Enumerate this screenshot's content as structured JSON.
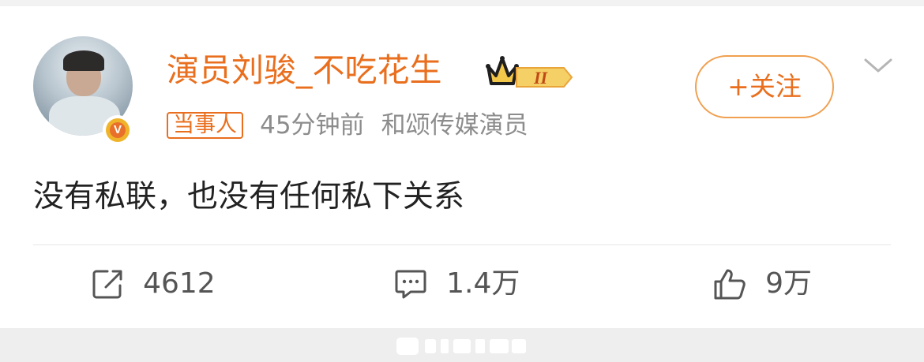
{
  "post": {
    "username": "演员刘骏_不吃花生",
    "badge_level": "II",
    "verified_badge_letter": "V",
    "tag": "当事人",
    "time": "45分钟前",
    "source": "和颂传媒演员",
    "follow_label": "+关注",
    "text": "没有私联，也没有任何私下关系"
  },
  "actions": {
    "repost_count": "4612",
    "comment_count": "1.4万",
    "like_count": "9万"
  },
  "icons": {
    "repost": "repost-icon",
    "comment": "comment-icon",
    "like": "thumbs-up-icon",
    "more": "chevron-down-icon",
    "crown": "crown-icon"
  },
  "colors": {
    "accent": "#e96f1e",
    "text": "#222222",
    "meta": "#8c8c8c",
    "action": "#555555"
  }
}
